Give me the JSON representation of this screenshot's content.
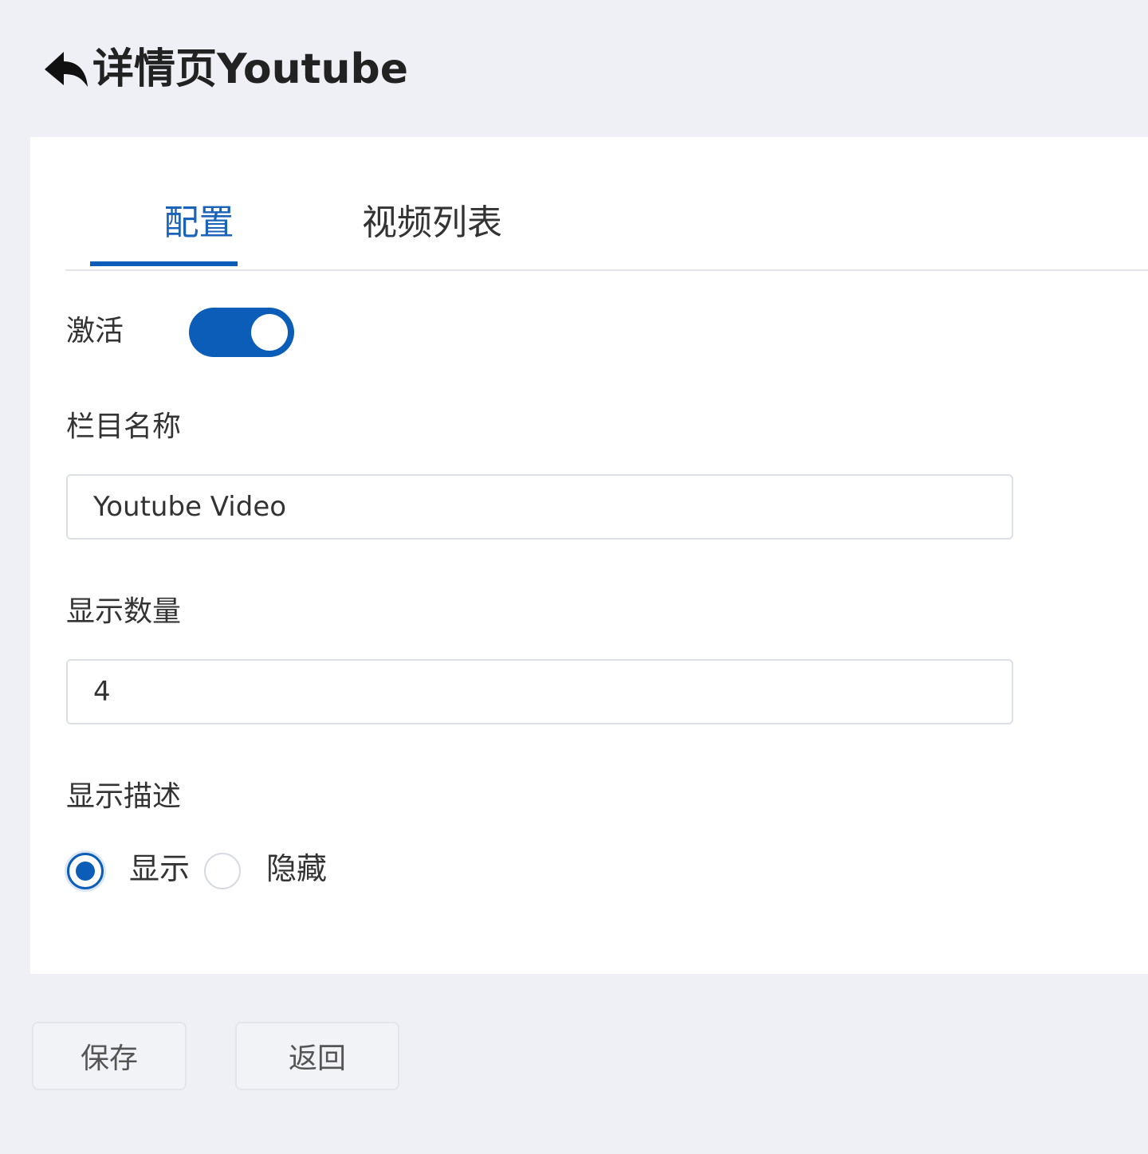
{
  "header": {
    "back_icon": "reply-arrow-icon",
    "title": "详情页Youtube"
  },
  "tabs": [
    {
      "label": "配置",
      "active": true
    },
    {
      "label": "视频列表",
      "active": false
    }
  ],
  "form": {
    "active_label": "激活",
    "active_value": true,
    "column_name_label": "栏目名称",
    "column_name_value": "Youtube Video",
    "display_count_label": "显示数量",
    "display_count_value": "4",
    "show_description_label": "显示描述",
    "show_description_options": [
      {
        "label": "显示",
        "checked": true
      },
      {
        "label": "隐藏",
        "checked": false
      }
    ]
  },
  "actions": {
    "save_label": "保存",
    "back_label": "返回"
  },
  "colors": {
    "accent": "#0b5db8",
    "background": "#eff0f5",
    "card": "#ffffff"
  }
}
